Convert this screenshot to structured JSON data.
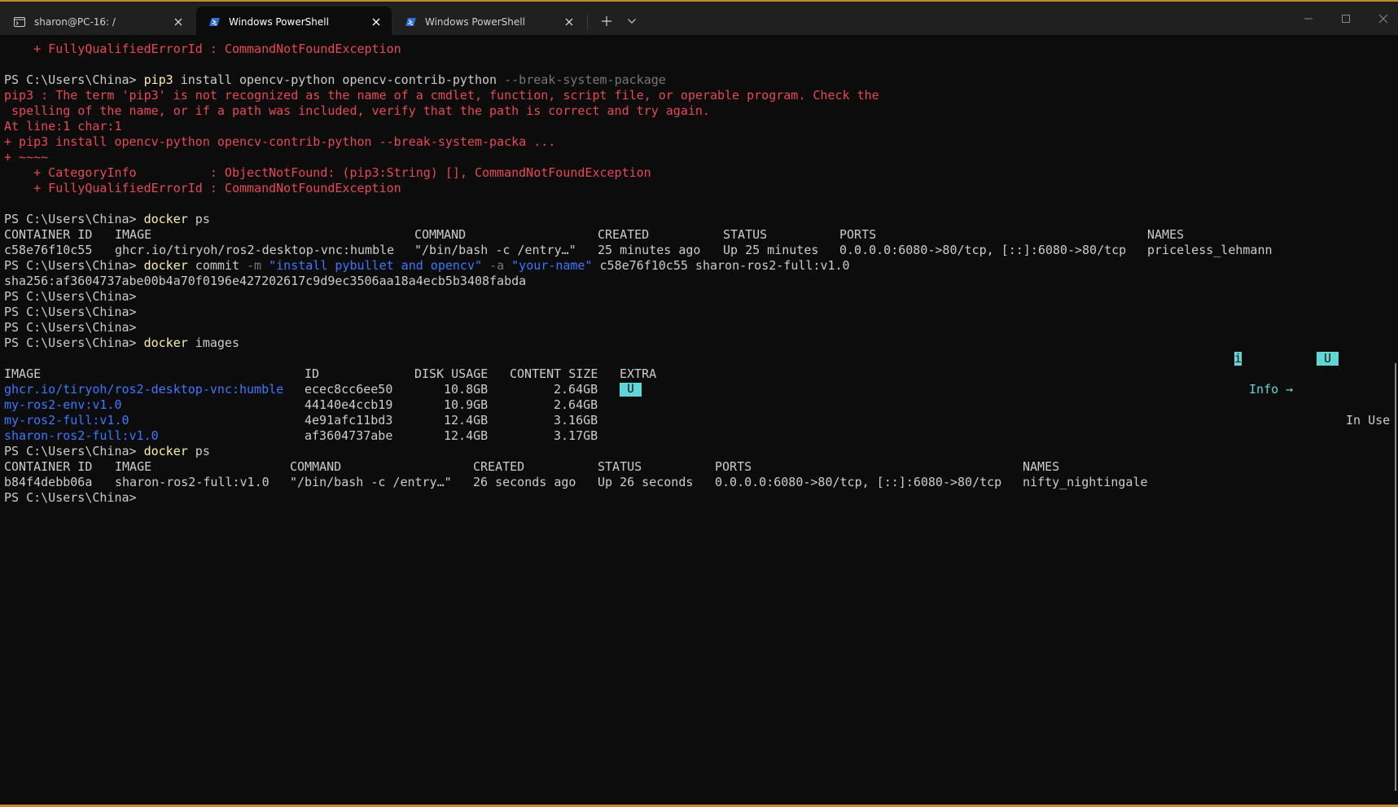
{
  "tabs": [
    {
      "title": "sharon@PC-16: /",
      "icon": "terminal-icon",
      "active": false
    },
    {
      "title": "Windows PowerShell",
      "icon": "powershell-icon",
      "active": true
    },
    {
      "title": "Windows PowerShell",
      "icon": "powershell-icon",
      "active": false
    }
  ],
  "colors": {
    "background": "#0c0c0c",
    "titlebar": "#202020",
    "error": "#e74856",
    "command": "#f9f1a5",
    "flag": "#767676",
    "string": "#3b78ff",
    "highlight": "#61d6d6",
    "accent": "#c58a2a"
  },
  "prompt": "PS C:\\Users\\China>",
  "lines": {
    "err_head": "    + FullyQualifiedErrorId : CommandNotFoundException",
    "pip_cmd": "pip3",
    "pip_args": " install opencv-python opencv-contrib-python ",
    "pip_flag": "--break-system-package",
    "err1": "pip3 : The term 'pip3' is not recognized as the name of a cmdlet, function, script file, or operable program. Check the",
    "err2": " spelling of the name, or if a path was included, verify that the path is correct and try again.",
    "err3": "At line:1 char:1",
    "err4": "+ pip3 install opencv-python opencv-contrib-python --break-system-packa ...",
    "err5": "+ ~~~~",
    "err6": "    + CategoryInfo          : ObjectNotFound: (pip3:String) [], CommandNotFoundException",
    "err7": "    + FullyQualifiedErrorId : CommandNotFoundException",
    "docker": "docker",
    "ps_arg": " ps",
    "commit": " commit ",
    "flag_m": "-m",
    "msg": "\"install pybullet and opencv\"",
    "flag_a": "-a",
    "author": "\"your-name\"",
    "commit_rest": " c58e76f10c55 sharon-ros2-full:v1.0",
    "sha": "sha256:af3604737abe00b4a70f0196e427202617c9d9ec3506aa18a4ecb5b3408fabda",
    "images_arg": " images"
  },
  "ps1": {
    "headers": [
      "CONTAINER ID",
      "IMAGE",
      "COMMAND",
      "CREATED",
      "STATUS",
      "PORTS",
      "NAMES"
    ],
    "rows": [
      [
        "c58e76f10c55",
        "ghcr.io/tiryoh/ros2-desktop-vnc:humble",
        "\"/bin/bash -c /entry…\"",
        "25 minutes ago",
        "Up 25 minutes",
        "0.0.0.0:6080->80/tcp, [::]:6080->80/tcp",
        "priceless_lehmann"
      ]
    ]
  },
  "legend": {
    "info_key": "i",
    "info_label": " Info →",
    "use_key": "U",
    "use_label": " In Use"
  },
  "images": {
    "headers": [
      "IMAGE",
      "ID",
      "DISK USAGE",
      "CONTENT SIZE",
      "EXTRA"
    ],
    "rows": [
      [
        "ghcr.io/tiryoh/ros2-desktop-vnc:humble",
        "ecec8cc6ee50",
        "10.8GB",
        "2.64GB",
        "U"
      ],
      [
        "my-ros2-env:v1.0",
        "44140e4ccb19",
        "10.9GB",
        "2.64GB",
        ""
      ],
      [
        "my-ros2-full:v1.0",
        "4e91afc11bd3",
        "12.4GB",
        "3.16GB",
        ""
      ],
      [
        "sharon-ros2-full:v1.0",
        "af3604737abe",
        "12.4GB",
        "3.17GB",
        ""
      ]
    ]
  },
  "ps2": {
    "headers": [
      "CONTAINER ID",
      "IMAGE",
      "COMMAND",
      "CREATED",
      "STATUS",
      "PORTS",
      "NAMES"
    ],
    "rows": [
      [
        "b84f4debb06a",
        "sharon-ros2-full:v1.0",
        "\"/bin/bash -c /entry…\"",
        "26 seconds ago",
        "Up 26 seconds",
        "0.0.0.0:6080->80/tcp, [::]:6080->80/tcp",
        "nifty_nightingale"
      ]
    ]
  }
}
